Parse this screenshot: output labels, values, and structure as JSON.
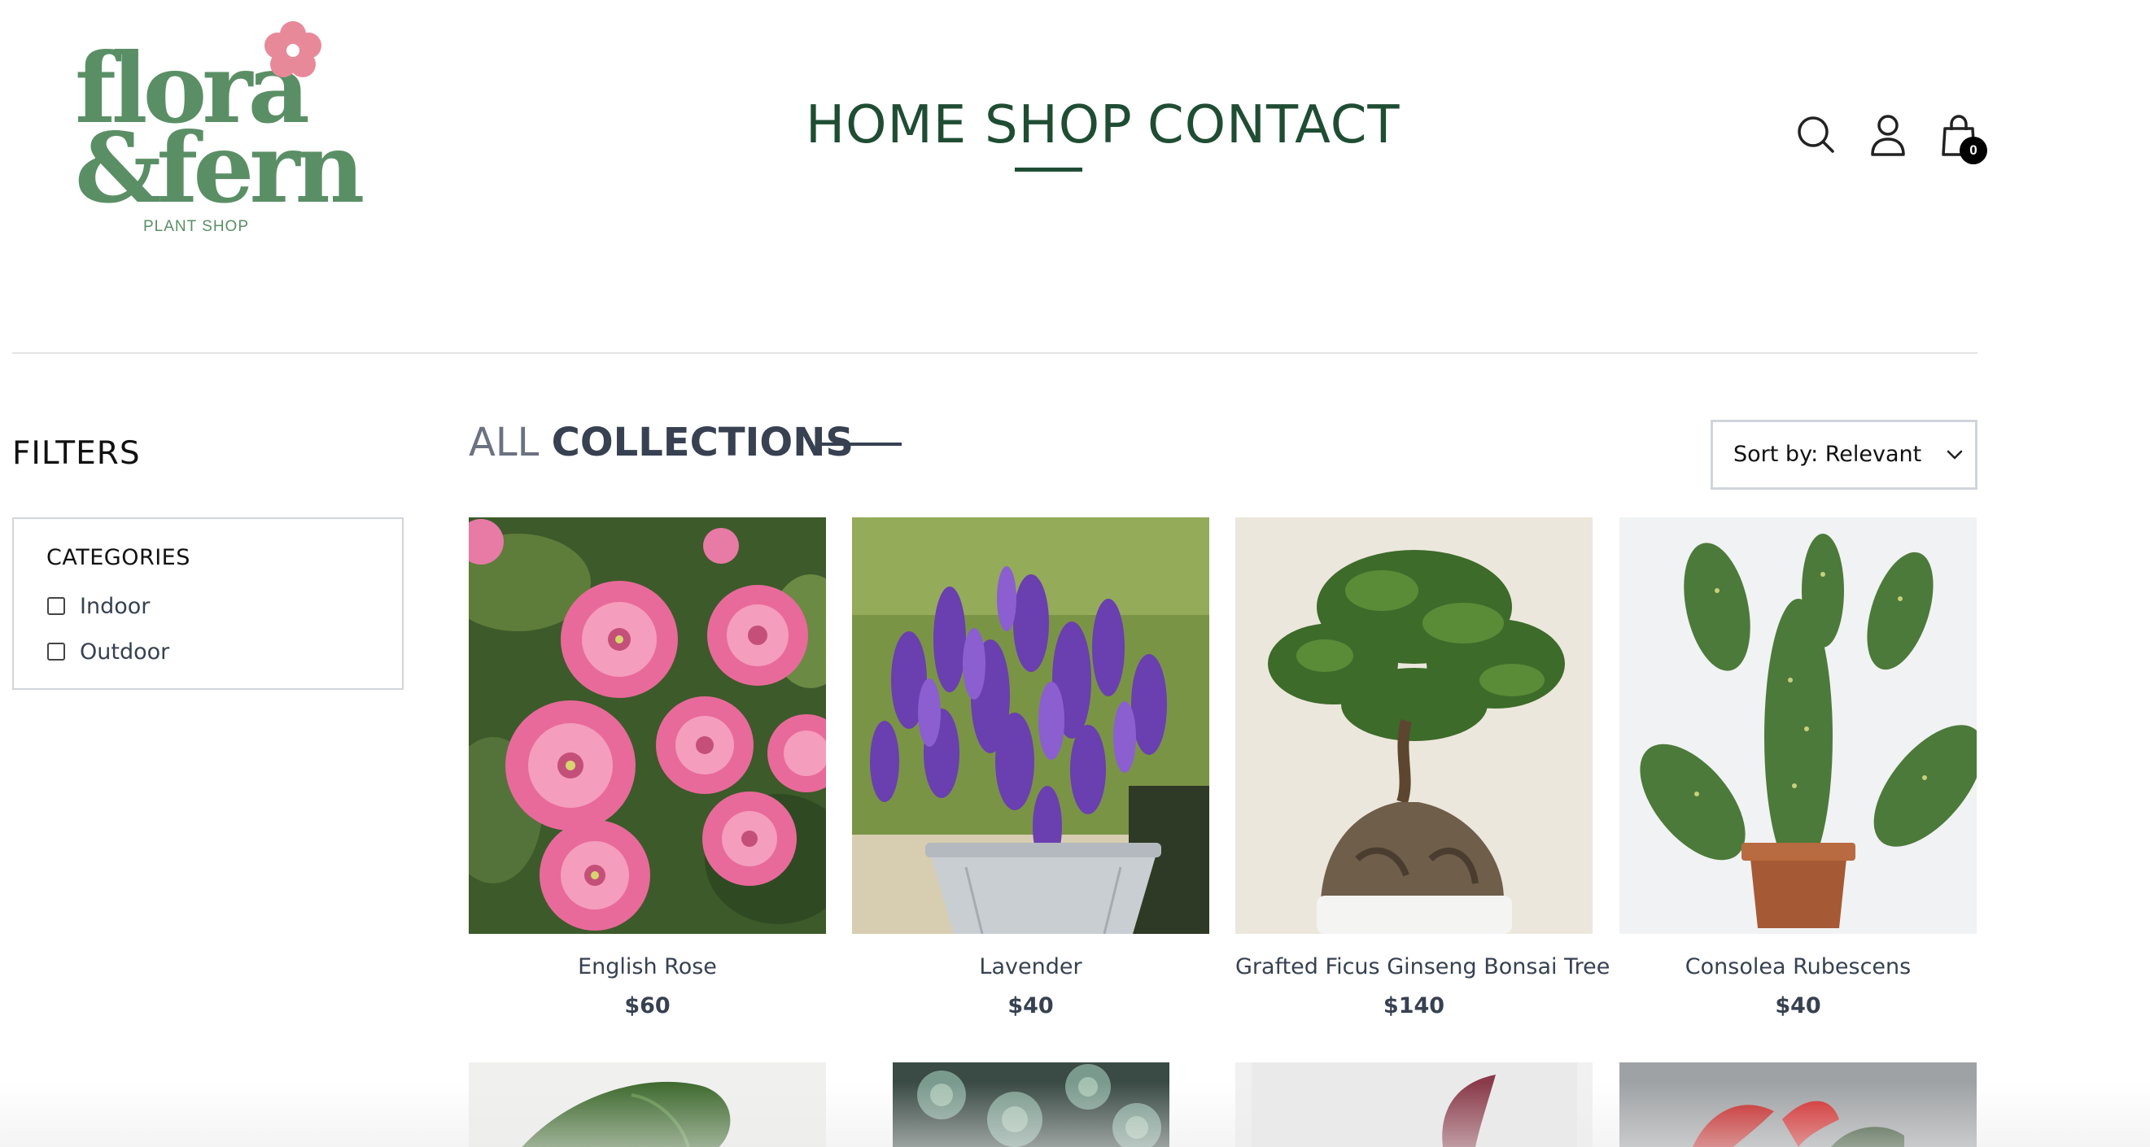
{
  "brand": {
    "logo_line1": "flora",
    "logo_line2": "&fern",
    "logo_subtitle": "PLANT SHOP",
    "logo_text_color": "#5a8f65",
    "flower_color": "#e8899a"
  },
  "nav": {
    "items": [
      {
        "label": "HOME",
        "active": false
      },
      {
        "label": "SHOP",
        "active": true
      },
      {
        "label": "CONTACT",
        "active": false
      }
    ],
    "color": "#1f4d33"
  },
  "header_icons": {
    "search": "search-icon",
    "account": "user-icon",
    "cart": "shopping-bag-icon",
    "cart_count": "0"
  },
  "filters": {
    "title": "FILTERS",
    "categories": {
      "heading": "CATEGORIES",
      "options": [
        {
          "label": "Indoor",
          "checked": false
        },
        {
          "label": "Outdoor",
          "checked": false
        }
      ]
    }
  },
  "collection": {
    "title_light": "ALL",
    "title_bold": "COLLECTIONS"
  },
  "sort": {
    "selected": "Sort by: Relevant"
  },
  "products": [
    {
      "name": "English Rose",
      "price": "$60"
    },
    {
      "name": "Lavender",
      "price": "$40"
    },
    {
      "name": "Grafted Ficus Ginseng Bonsai Tree",
      "price": "$140"
    },
    {
      "name": "Consolea Rubescens",
      "price": "$40"
    }
  ]
}
